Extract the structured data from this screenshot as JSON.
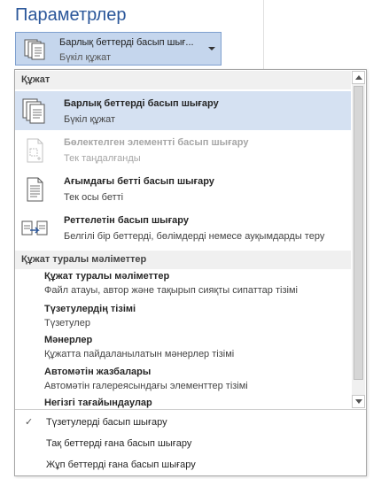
{
  "section": {
    "title": "Параметрлер"
  },
  "combo": {
    "title": "Барлық беттерді басып шығ...",
    "subtitle": "Бүкіл құжат",
    "icon": "pages-stack-icon"
  },
  "groups": {
    "document": {
      "header": "Құжат",
      "items": [
        {
          "title": "Барлық беттерді басып шығару",
          "desc": "Бүкіл құжат",
          "icon": "pages-stack-icon",
          "state": "selected"
        },
        {
          "title": "Бөлектелген элементті басып шығару",
          "desc": "Тек таңдалғанды",
          "icon": "selection-page-icon",
          "state": "disabled"
        },
        {
          "title": "Ағымдағы бетті басып шығару",
          "desc": "Тек осы бетті",
          "icon": "single-page-icon",
          "state": "normal"
        },
        {
          "title": "Реттелетін басып шығару",
          "desc": "Белгілі бір беттерді, бөлімдерді немесе ауқымдарды теру",
          "icon": "custom-range-icon",
          "state": "normal"
        }
      ]
    },
    "properties": {
      "header": "Құжат туралы мәліметтер",
      "items": [
        {
          "title": "Құжат туралы мәліметтер",
          "desc": "Файл атауы, автор және тақырып сияқты сипаттар тізімі"
        },
        {
          "title": "Түзетулердің тізімі",
          "desc": "Түзетулер"
        },
        {
          "title": "Мәнерлер",
          "desc": "Құжатта пайдаланылатын мәнерлер тізімі"
        },
        {
          "title": "Автомәтін жазбалары",
          "desc": "Автомәтін галереясындағы элементтер тізімі"
        },
        {
          "title": "Негізгі тағайындаулар",
          "desc": ""
        }
      ]
    }
  },
  "options": [
    {
      "label": "Түзетулерді басып шығару",
      "checked": true
    },
    {
      "label": "Тақ беттерді ғана басып шығару",
      "checked": false
    },
    {
      "label": "Жұп беттерді ғана басып шығару",
      "checked": false
    }
  ],
  "check_glyph": "✓",
  "colors": {
    "accent": "#2b579a",
    "selected_bg": "#d5e1f2",
    "combo_bg": "#c5d6ed",
    "disabled_text": "#a6a6a6"
  }
}
